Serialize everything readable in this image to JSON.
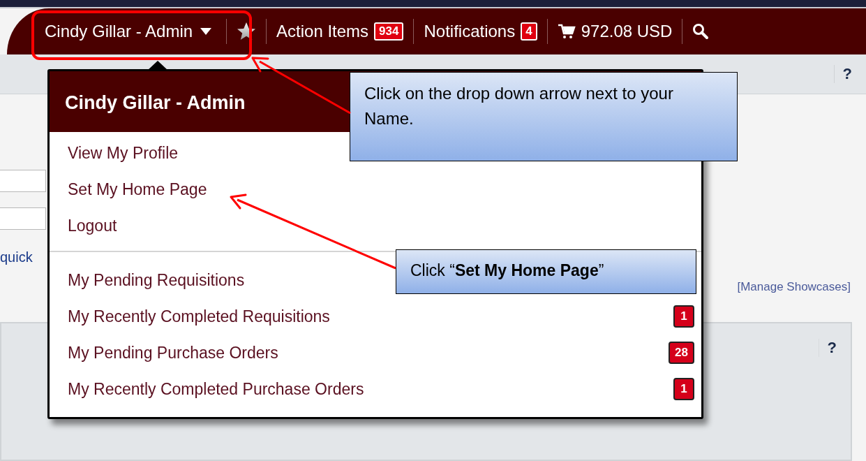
{
  "top_bar": {
    "user_menu": {
      "label": "Cindy Gillar - Admin",
      "expanded": true
    },
    "action_items": {
      "label": "Action Items",
      "count": "934"
    },
    "notifications": {
      "label": "Notifications",
      "count": "4"
    },
    "cart": {
      "amount": "972.08 USD"
    }
  },
  "sub_bar": {
    "help": "?"
  },
  "page": {
    "quick_link": "quick",
    "manage_showcases": "[Manage Showcases]",
    "panel_help": "?"
  },
  "dropdown": {
    "title": "Cindy Gillar - Admin",
    "sections": [
      {
        "items": [
          {
            "label": "View My Profile"
          },
          {
            "label": "Set My Home Page"
          },
          {
            "label": "Logout"
          }
        ]
      },
      {
        "items": [
          {
            "label": "My Pending Requisitions"
          },
          {
            "label": "My Recently Completed Requisitions",
            "count": "1"
          },
          {
            "label": "My Pending Purchase Orders",
            "count": "28"
          },
          {
            "label": "My Recently Completed Purchase Orders",
            "count": "1"
          }
        ]
      }
    ]
  },
  "callouts": [
    {
      "text": "Click on the drop down arrow next to your Name."
    },
    {
      "text": "Click “**Set My Home Page**”"
    }
  ]
}
